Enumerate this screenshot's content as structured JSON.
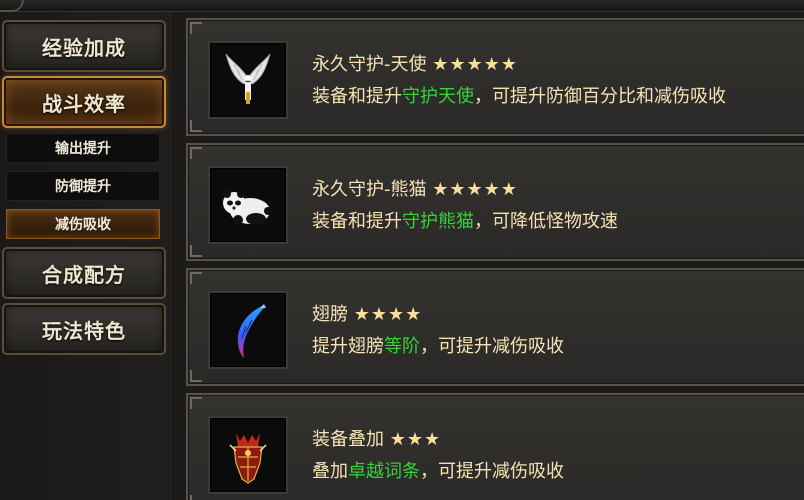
{
  "sidebar": {
    "buttons": [
      {
        "label": "经验加成"
      },
      {
        "label": "战斗效率"
      },
      {
        "label": "合成配方"
      },
      {
        "label": "玩法特色"
      }
    ],
    "sub_items": [
      {
        "label": "输出提升"
      },
      {
        "label": "防御提升"
      },
      {
        "label": "减伤吸收"
      }
    ],
    "active_button": "战斗效率",
    "active_sub_item": "减伤吸收"
  },
  "cards": [
    {
      "title": "永久守护-天使",
      "stars": "★★★★★",
      "star_count": 5,
      "icon": "angel-wings-icon",
      "desc_prefix": "装备和提升",
      "desc_highlight": "守护天使",
      "desc_suffix": "，可提升防御百分比和减伤吸收"
    },
    {
      "title": "永久守护-熊猫",
      "stars": "★★★★★",
      "star_count": 5,
      "icon": "panda-icon",
      "desc_prefix": "装备和提升",
      "desc_highlight": "守护熊猫",
      "desc_suffix": "，可降低怪物攻速"
    },
    {
      "title": "翅膀",
      "stars": "★★★★",
      "star_count": 4,
      "icon": "wings-icon",
      "desc_prefix": "提升翅膀",
      "desc_highlight": "等阶",
      "desc_suffix": "，可提升减伤吸收"
    },
    {
      "title": "装备叠加",
      "stars": "★★★",
      "star_count": 3,
      "icon": "armor-icon",
      "desc_prefix": "叠加",
      "desc_highlight": "卓越词条",
      "desc_suffix": "，可提升减伤吸收"
    }
  ],
  "colors": {
    "text": "#f5e3b4",
    "highlight": "#35d23a",
    "active_border": "#c98a2f"
  }
}
